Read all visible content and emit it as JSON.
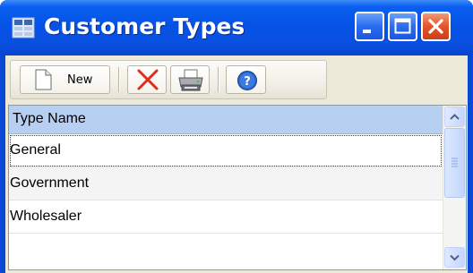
{
  "window": {
    "title": "Customer Types",
    "icon": "grid-window-icon",
    "controls": [
      "minimize-icon",
      "maximize-icon",
      "close-icon"
    ],
    "colors": {
      "titlebar": "#0553e6",
      "close": "#e3532a",
      "client": "#ece9d8"
    }
  },
  "toolbar": {
    "new_label": "New",
    "new_icon": "new-document-icon",
    "delete_icon": "delete-x-icon",
    "print_icon": "printer-icon",
    "help_icon": "help-icon"
  },
  "grid": {
    "columns": [
      "Type Name"
    ],
    "rows": [
      "General",
      "Government",
      "Wholesaler"
    ],
    "selected_row": "General",
    "header_color": "#b7cff1"
  }
}
